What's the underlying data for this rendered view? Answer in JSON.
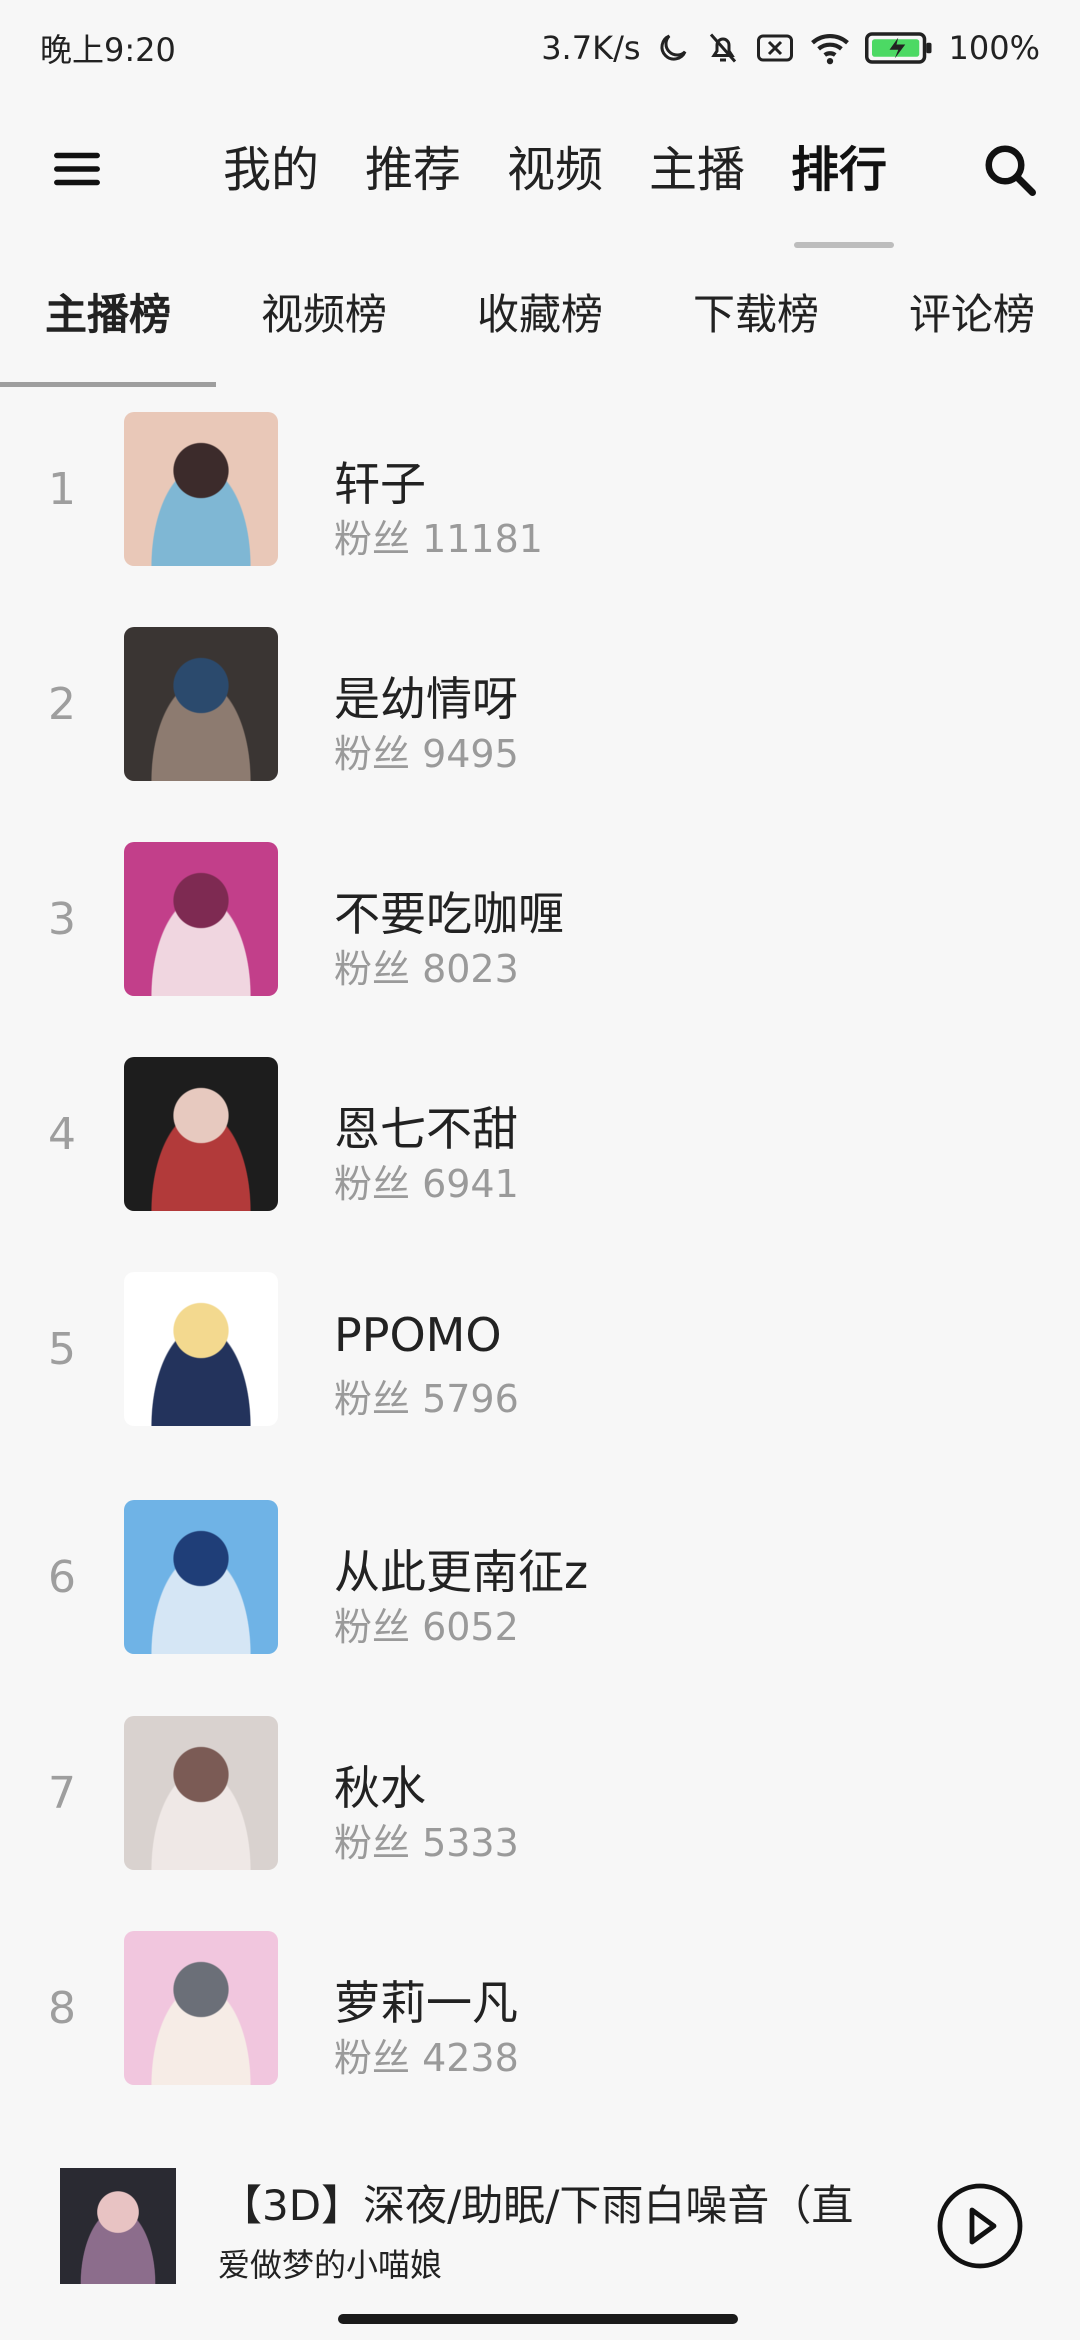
{
  "status_bar": {
    "time": "晚上9:20",
    "net_speed": "3.7K/s",
    "battery": "100%"
  },
  "top_nav": {
    "tabs": [
      {
        "label": "我的"
      },
      {
        "label": "推荐"
      },
      {
        "label": "视频"
      },
      {
        "label": "主播"
      },
      {
        "label": "排行"
      }
    ],
    "active_tab": "排行"
  },
  "sub_tabs": {
    "tabs": [
      {
        "label": "主播榜"
      },
      {
        "label": "视频榜"
      },
      {
        "label": "收藏榜"
      },
      {
        "label": "下载榜"
      },
      {
        "label": "评论榜"
      }
    ],
    "active_tab": "主播榜"
  },
  "ranking": [
    {
      "rank": "1",
      "name": "轩子",
      "fans": "粉丝 11181",
      "avatar_colors": [
        "#e9c8b8",
        "#3c2b2b",
        "#7fb7d4"
      ]
    },
    {
      "rank": "2",
      "name": "是幼情呀",
      "fans": "粉丝 9495",
      "avatar_colors": [
        "#3a3533",
        "#2b4a6d",
        "#8d7b70"
      ]
    },
    {
      "rank": "3",
      "name": "不要吃咖喱",
      "fans": "粉丝 8023",
      "avatar_colors": [
        "#c23f8a",
        "#7e2a52",
        "#f0d6e0"
      ]
    },
    {
      "rank": "4",
      "name": "恩七不甜",
      "fans": "粉丝 6941",
      "avatar_colors": [
        "#1d1d1d",
        "#e7c9bf",
        "#b23a3a"
      ]
    },
    {
      "rank": "5",
      "name": "PPOMO",
      "fans": "粉丝 5796",
      "avatar_colors": [
        "#ffffff",
        "#f3d98f",
        "#23335c"
      ]
    },
    {
      "rank": "6",
      "name": "从此更南征z",
      "fans": "粉丝 6052",
      "avatar_colors": [
        "#6fb3e6",
        "#1f3e78",
        "#d5e6f5"
      ]
    },
    {
      "rank": "7",
      "name": "秋水",
      "fans": "粉丝 5333",
      "avatar_colors": [
        "#d9d2cf",
        "#7b5b55",
        "#efe8e6"
      ]
    },
    {
      "rank": "8",
      "name": "萝莉一凡",
      "fans": "粉丝 4238",
      "avatar_colors": [
        "#f1c6de",
        "#6b6f78",
        "#f6ece6"
      ]
    }
  ],
  "player": {
    "title": "【3D】深夜/助眠/下雨白噪音（直",
    "artist": "爱做梦的小喵娘",
    "cover_colors": [
      "#2a2a32",
      "#e8c3c3",
      "#8c6d8c"
    ]
  }
}
